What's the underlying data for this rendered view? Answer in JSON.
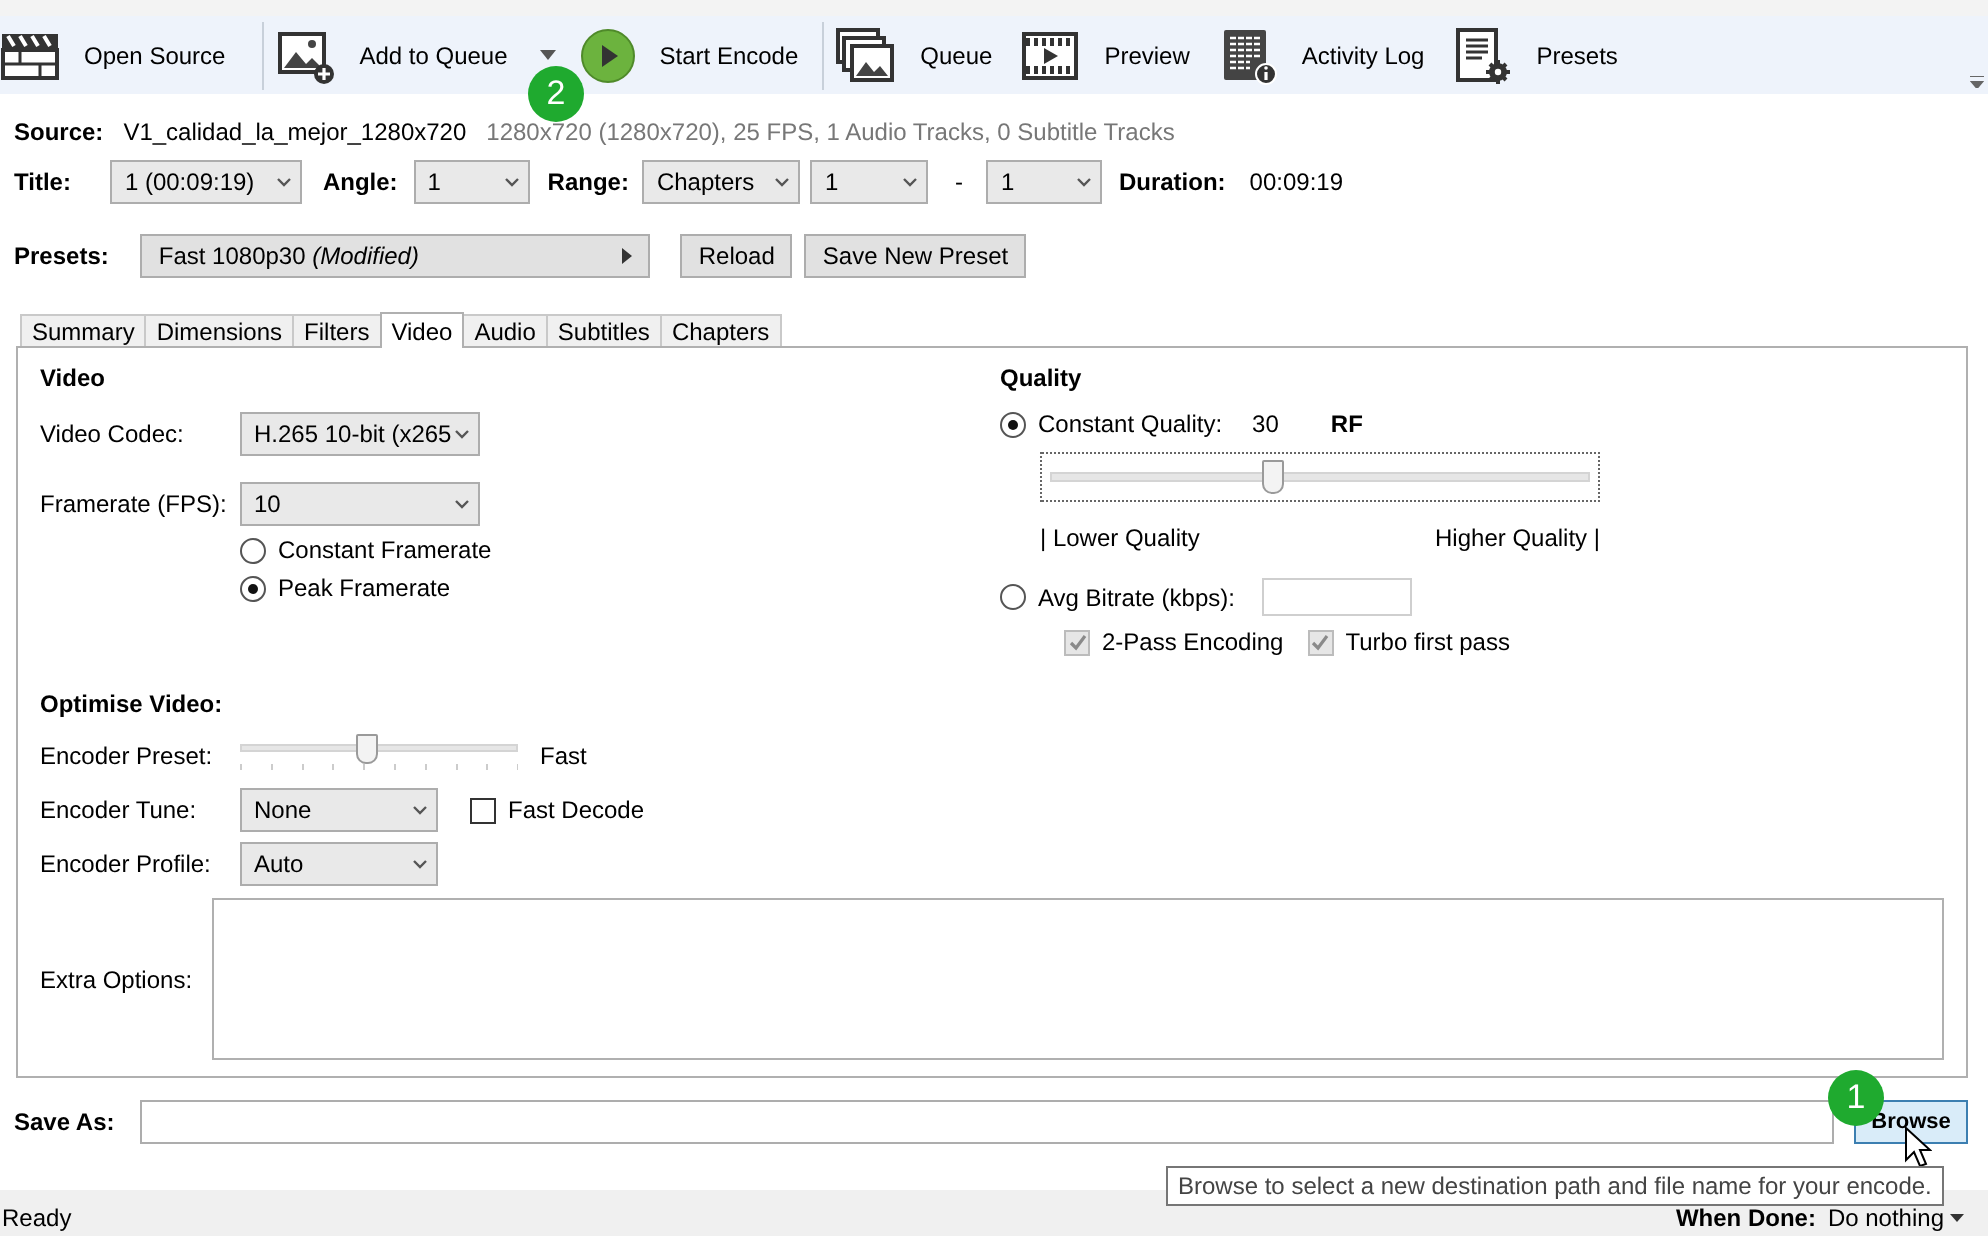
{
  "toolbar": {
    "items": [
      {
        "kind": "button",
        "label": "Open Source"
      },
      {
        "kind": "dropdown",
        "label": "Add to Queue"
      },
      {
        "kind": "button",
        "label": "Start Encode"
      },
      {
        "kind": "button",
        "label": "Queue"
      },
      {
        "kind": "button",
        "label": "Preview"
      },
      {
        "kind": "button",
        "label": "Activity Log"
      },
      {
        "kind": "button",
        "label": "Presets"
      }
    ]
  },
  "source": {
    "label": "Source:",
    "name": "V1_calidad_la_mejor_1280x720",
    "info": "1280x720 (1280x720), 25 FPS, 1 Audio Tracks, 0 Subtitle Tracks"
  },
  "title_row": {
    "title_label": "Title:",
    "title_value": "1 (00:09:19)",
    "angle_label": "Angle:",
    "angle_value": "1",
    "range_label": "Range:",
    "range_value": "Chapters",
    "range_start": "1",
    "range_separator": "-",
    "range_end": "1",
    "duration_label": "Duration:",
    "duration_value": "00:09:19"
  },
  "presets": {
    "label": "Presets:",
    "value": "Fast 1080p30  *(Modified)*",
    "buttons": [
      "Reload",
      "Save New Preset"
    ]
  },
  "tabs": [
    {
      "label": "Summary",
      "selected": false
    },
    {
      "label": "Dimensions",
      "selected": false
    },
    {
      "label": "Filters",
      "selected": false
    },
    {
      "label": "Video",
      "selected": true
    },
    {
      "label": "Audio",
      "selected": false
    },
    {
      "label": "Subtitles",
      "selected": false
    },
    {
      "label": "Chapters",
      "selected": false
    }
  ],
  "video": {
    "heading": "Video",
    "codec_label": "Video Codec:",
    "codec_value": "H.265 10-bit (x265",
    "framerate_label": "Framerate (FPS):",
    "framerate_value": "10",
    "framerate_modes": [
      {
        "label": "Constant Framerate",
        "selected": false
      },
      {
        "label": "Peak Framerate",
        "selected": true
      }
    ]
  },
  "quality": {
    "heading": "Quality",
    "modes": [
      {
        "label": "Constant Quality:",
        "selected": true
      },
      {
        "label": "Avg Bitrate (kbps):",
        "selected": false
      }
    ],
    "rf_value": "30",
    "rf_unit": "RF",
    "level": 0.41,
    "low_label": "| Lower Quality",
    "high_label": "Higher Quality |",
    "options": [
      {
        "label": "2-Pass Encoding",
        "checked": true,
        "disabled": true
      },
      {
        "label": "Turbo first pass",
        "checked": true,
        "disabled": true
      }
    ]
  },
  "optimise": {
    "heading": "Optimise Video:",
    "preset_label": "Encoder Preset:",
    "level": 0.45,
    "preset_value": "Fast",
    "tune_label": "Encoder Tune:",
    "tune_value": "None",
    "fast_decode": {
      "label": "Fast Decode",
      "checked": false
    },
    "profile_label": "Encoder Profile:",
    "profile_value": "Auto",
    "extra_label": "Extra Options:"
  },
  "save_as": {
    "label": "Save As:",
    "button": "Browse"
  },
  "status_bar": {
    "status": "Ready",
    "when_done_label": "When Done:",
    "when_done_value": "Do nothing"
  },
  "tooltip": {
    "text": "Browse to select a new destination path and file name for your encode."
  },
  "step_markers": [
    {
      "label": "2"
    },
    {
      "label": "1"
    }
  ]
}
